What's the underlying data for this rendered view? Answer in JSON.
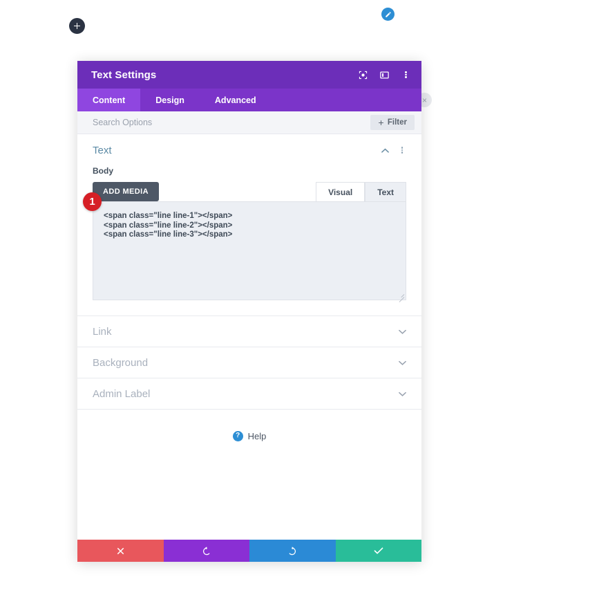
{
  "canvas": {
    "add_section_button": "+",
    "page_edit_icon": "pencil-icon",
    "module_close_icon": "×"
  },
  "modal": {
    "title": "Text Settings",
    "titlebar_icons": [
      {
        "name": "focus-target-icon"
      },
      {
        "name": "layout-columns-icon"
      },
      {
        "name": "kebab-menu-icon"
      }
    ],
    "tabs": [
      {
        "label": "Content",
        "active": true
      },
      {
        "label": "Design",
        "active": false
      },
      {
        "label": "Advanced",
        "active": false
      }
    ],
    "search": {
      "placeholder": "Search Options",
      "value": ""
    },
    "filter_button": {
      "label": "Filter",
      "icon": "plus-icon"
    },
    "sections": {
      "text": {
        "title": "Text",
        "field_label": "Body",
        "add_media_label": "ADD MEDIA",
        "editor_modes": [
          {
            "label": "Visual",
            "active": false
          },
          {
            "label": "Text",
            "active": true
          }
        ],
        "code_value": "<span class=\"line line-1\"></span>\n<span class=\"line line-2\"></span>\n<span class=\"line line-3\"></span>"
      },
      "collapsed": [
        {
          "title": "Link"
        },
        {
          "title": "Background"
        },
        {
          "title": "Admin Label"
        }
      ]
    },
    "help": {
      "label": "Help",
      "icon_glyph": "?"
    },
    "footer_buttons": [
      {
        "name": "cancel-button",
        "icon": "close-icon"
      },
      {
        "name": "undo-button",
        "icon": "undo-icon"
      },
      {
        "name": "redo-button",
        "icon": "redo-icon"
      },
      {
        "name": "save-button",
        "icon": "check-icon"
      }
    ]
  },
  "markers": [
    {
      "label": "1"
    }
  ],
  "colors": {
    "titlebar": "#6c2eb9",
    "tabbar": "#7b34c9",
    "tab_active": "#8f46e0",
    "marker_red": "#d61f26",
    "cancel": "#e8575c",
    "undo": "#8a2fd4",
    "redo": "#2b8ad6",
    "save": "#29bd99",
    "accent_blue": "#2d8ed4"
  }
}
